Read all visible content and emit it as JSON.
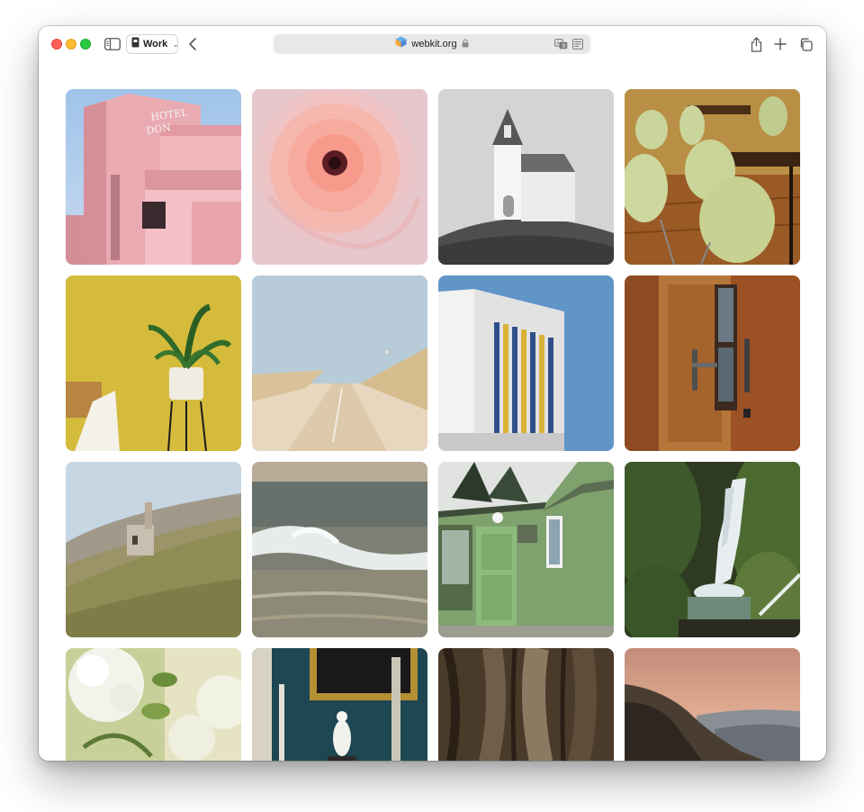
{
  "window": {
    "tab_group_label": "Work",
    "address": "webkit.org"
  },
  "toolbar_icons": {
    "sidebar": "sidebar-icon",
    "tab_group": "tab-group-icon",
    "back": "chevron-left-icon",
    "site_favicon": "webkit-logo-icon",
    "lock": "lock-icon",
    "translate": "translate-icon",
    "reader": "reader-icon",
    "share": "share-icon",
    "new_tab": "plus-icon",
    "tab_overview": "tab-overview-icon"
  },
  "gallery": {
    "photos": [
      {
        "subject": "pink-hotel-building"
      },
      {
        "subject": "pink-ranunculus-flower"
      },
      {
        "subject": "white-chapel-on-hill"
      },
      {
        "subject": "green-cafe-chairs"
      },
      {
        "subject": "plant-on-yellow-wall"
      },
      {
        "subject": "sand-dune-path"
      },
      {
        "subject": "modern-white-building"
      },
      {
        "subject": "wooden-door"
      },
      {
        "subject": "ruin-on-hillside"
      },
      {
        "subject": "ocean-wave"
      },
      {
        "subject": "green-wooden-house"
      },
      {
        "subject": "jungle-waterfall"
      },
      {
        "subject": "white-hydrangea"
      },
      {
        "subject": "teal-wall-gold-frame"
      },
      {
        "subject": "tree-bark"
      },
      {
        "subject": "mountains-at-dusk"
      }
    ]
  }
}
